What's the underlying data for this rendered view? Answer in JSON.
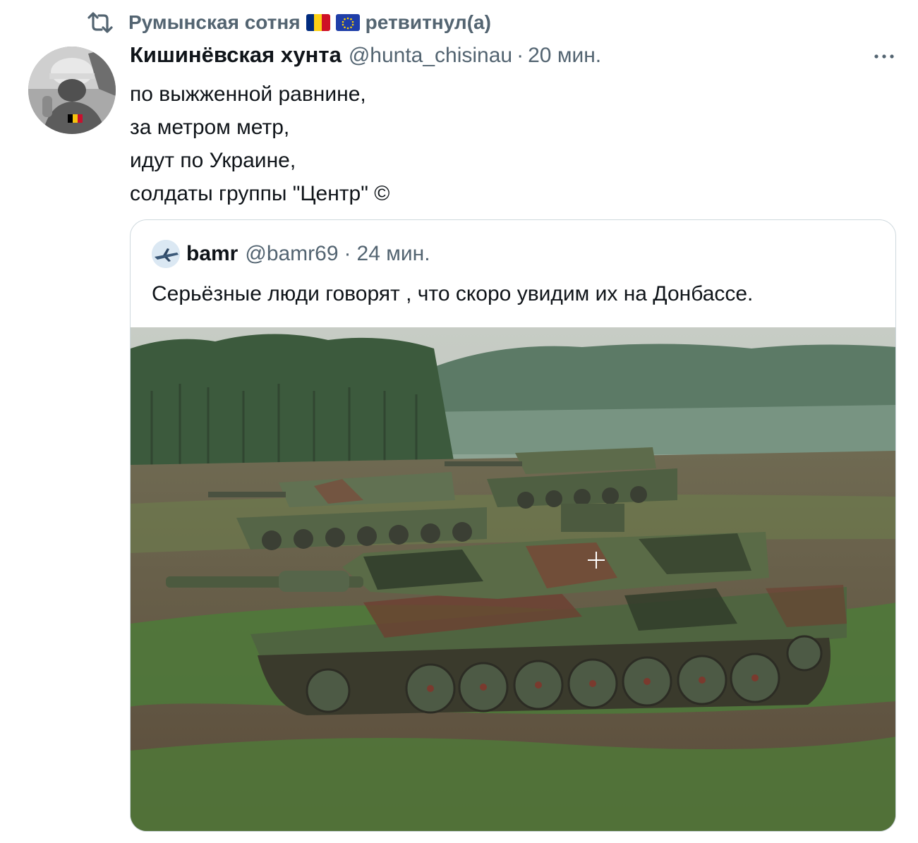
{
  "retweet": {
    "icon": "retweet-icon",
    "retweeter_name": "Румынская сотня",
    "action_label": "ретвитнул(а)",
    "flags": [
      "romania-flag",
      "eu-flag"
    ]
  },
  "tweet": {
    "author_name": "Кишинёвская хунта",
    "author_handle": "@hunta_chisinau",
    "separator": "·",
    "time": "20 мин.",
    "more_icon": "more-icon",
    "lines": [
      "по выжженной равнине,",
      "за метром метр,",
      "идут по Украине,",
      "солдаты группы \"Центр\" ©"
    ]
  },
  "quote": {
    "author_name": "bamr",
    "author_handle": "@bamr69",
    "separator": "·",
    "time": "24 мин.",
    "text": "Серьёзные люди говорят , что скоро увидим их на Донбассе.",
    "image": "tanks-on-field-photo"
  },
  "colors": {
    "text_primary": "#0f1419",
    "text_secondary": "#536471",
    "border": "#cfd9de"
  }
}
